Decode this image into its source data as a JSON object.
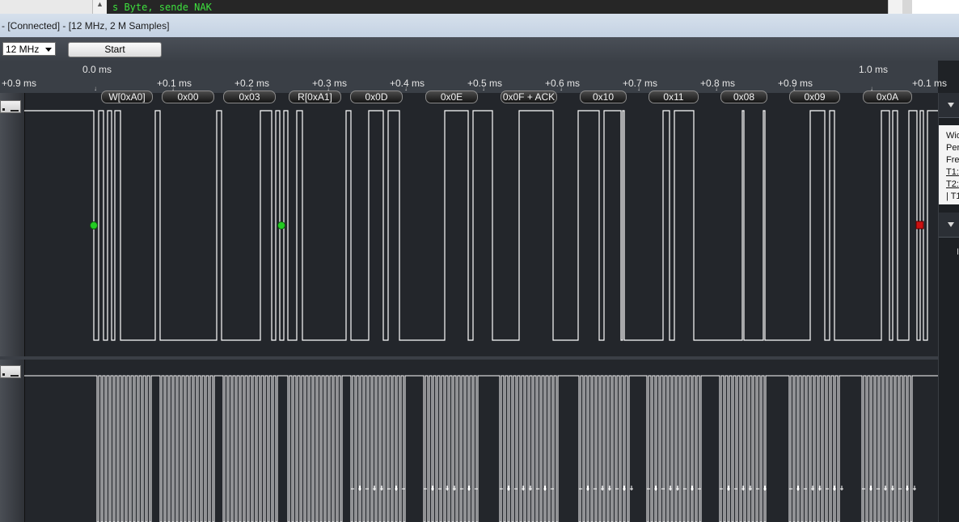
{
  "background_window": {
    "console_text": "s Byte, sende NAK",
    "scroll_arrow": "▲"
  },
  "window": {
    "title": "- [Connected] - [12 MHz, 2 M Samples]"
  },
  "toolbar": {
    "sample_rate": "12 MHz",
    "start_label": "Start"
  },
  "ruler": {
    "origin_label": "0.0 ms",
    "second_label": "1.0 ms",
    "offset_labels": [
      "+0.9 ms",
      "+0.1 ms",
      "+0.2 ms",
      "+0.3 ms",
      "+0.4 ms",
      "+0.5 ms",
      "+0.6 ms",
      "+0.7 ms",
      "+0.8 ms",
      "+0.9 ms",
      "+0.1 ms"
    ]
  },
  "decoded_bytes": [
    "W[0xA0]",
    "0x00",
    "0x03",
    "R[0xA1]",
    "0x0D",
    "0x0E",
    "0x0F + ACK",
    "0x10",
    "0x11",
    "0x08",
    "0x09",
    "0x0A"
  ],
  "side_panel": {
    "measure_items": [
      "Wid",
      "Per",
      "Fre",
      "T1:",
      "T2:",
      "| T1"
    ],
    "second_section_glyph": "I"
  },
  "colors": {
    "trace": "#ffffff",
    "start_marker": "#22cc22",
    "stop_marker": "#cc1111",
    "console_text": "#3ee03e"
  }
}
